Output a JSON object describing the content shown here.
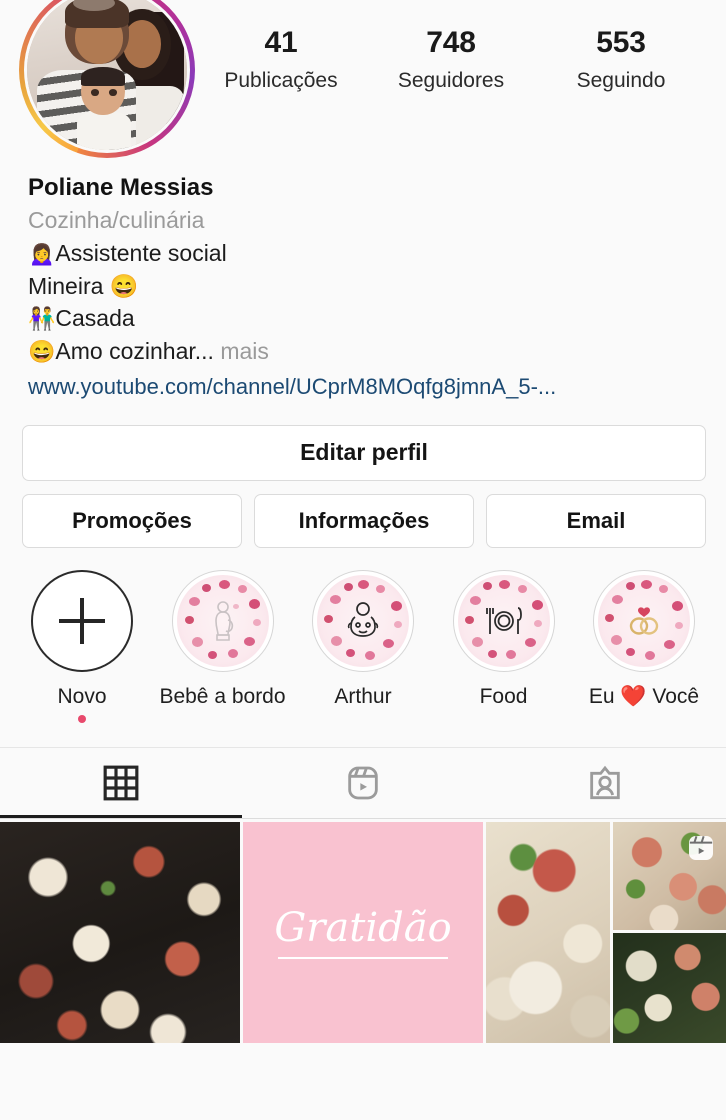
{
  "profile": {
    "avatar_alt": "Foto de perfil: homem, mulher e bebê",
    "name": "Poliane Messias",
    "category": "Cozinha/culinária",
    "bio_lines": [
      {
        "emoji": "🙍‍♀️",
        "text": "Assistente social"
      },
      {
        "emoji": "",
        "text": "Mineira 😄"
      },
      {
        "emoji": "👫",
        "text": "Casada"
      },
      {
        "emoji": "😄",
        "text": "Amo cozinhar..."
      }
    ],
    "more_label": "mais",
    "link": "www.youtube.com/channel/UCprM8MOqfg8jmnA_5-..."
  },
  "stats": [
    {
      "value": "41",
      "label": "Publicações"
    },
    {
      "value": "748",
      "label": "Seguidores"
    },
    {
      "value": "553",
      "label": "Seguindo"
    }
  ],
  "actions": {
    "edit_profile": "Editar perfil",
    "promotions": "Promoções",
    "information": "Informações",
    "email": "Email"
  },
  "highlights": [
    {
      "label": "Novo",
      "icon": "plus-icon",
      "is_new": true,
      "has_dot": true
    },
    {
      "label": "Bebê a bordo",
      "icon": "pregnant-woman-icon",
      "is_new": false,
      "has_dot": false
    },
    {
      "label": "Arthur",
      "icon": "baby-icon",
      "is_new": false,
      "has_dot": false
    },
    {
      "label": "Food",
      "icon": "plate-cutlery-icon",
      "is_new": false,
      "has_dot": false
    },
    {
      "label": "Eu ❤️ Você",
      "icon": "wedding-rings-icon",
      "is_new": false,
      "has_dot": false
    }
  ],
  "tabs": [
    {
      "name": "grid-tab",
      "icon": "grid-icon",
      "active": true
    },
    {
      "name": "igtv-tab",
      "icon": "igtv-icon",
      "active": false
    },
    {
      "name": "tagged-tab",
      "icon": "tagged-person-icon",
      "active": false
    }
  ],
  "posts": [
    {
      "type": "photo",
      "description": "Prato de comida em frigideira escura",
      "has_video_badge": false
    },
    {
      "type": "card",
      "description": "Cartão rosa com texto",
      "text": "Gratidão",
      "has_video_badge": false
    },
    {
      "type": "photo",
      "description": "Arroz com linguiça e legumes",
      "has_video_badge": false
    },
    {
      "type": "photo",
      "description": "Carne com pimentão e ervilha",
      "has_video_badge": true
    },
    {
      "type": "photo",
      "description": "Comida com vegetais verdes",
      "has_video_badge": false
    }
  ],
  "colors": {
    "background": "#fafafa",
    "link": "#1c4a73",
    "muted": "#9a9a9a",
    "text": "#1c1c1c",
    "pink_card": "#f9c2d0",
    "accent_dot": "#e8496c",
    "border": "#dbdbdb"
  }
}
